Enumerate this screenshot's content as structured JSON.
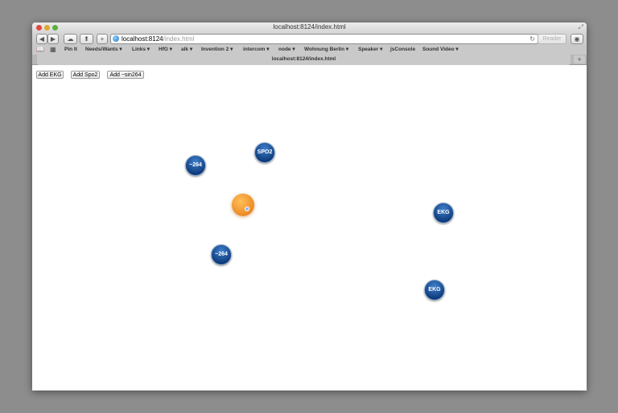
{
  "window": {
    "title": "localhost:8124/index.html"
  },
  "toolbar": {
    "url_host": "localhost:8124",
    "url_path": "/index.html",
    "reader_label": "Reader",
    "back_icon": "back-icon",
    "forward_icon": "forward-icon"
  },
  "bookmarks": [
    "Pin It",
    "Needs/Wants ▾",
    "Links ▾",
    "HfG ▾",
    "alk ▾",
    "Invention 2 ▾",
    "intercom ▾",
    "node ▾",
    "Wohnung Berlin ▾",
    "Speaker ▾",
    "jsConsole",
    "Sound Video ▾"
  ],
  "tab": {
    "label": "localhost:8124/index.html"
  },
  "buttons": {
    "add_ekg": "Add EKG",
    "add_spo2": "Add Spo2",
    "add_sin": "Add ~sin264"
  },
  "nodes": [
    "SPO2",
    "~264",
    "EKG",
    "~264",
    "EKG"
  ],
  "colors": {
    "node": "#1d5aa8",
    "orb": "#f0952e"
  }
}
